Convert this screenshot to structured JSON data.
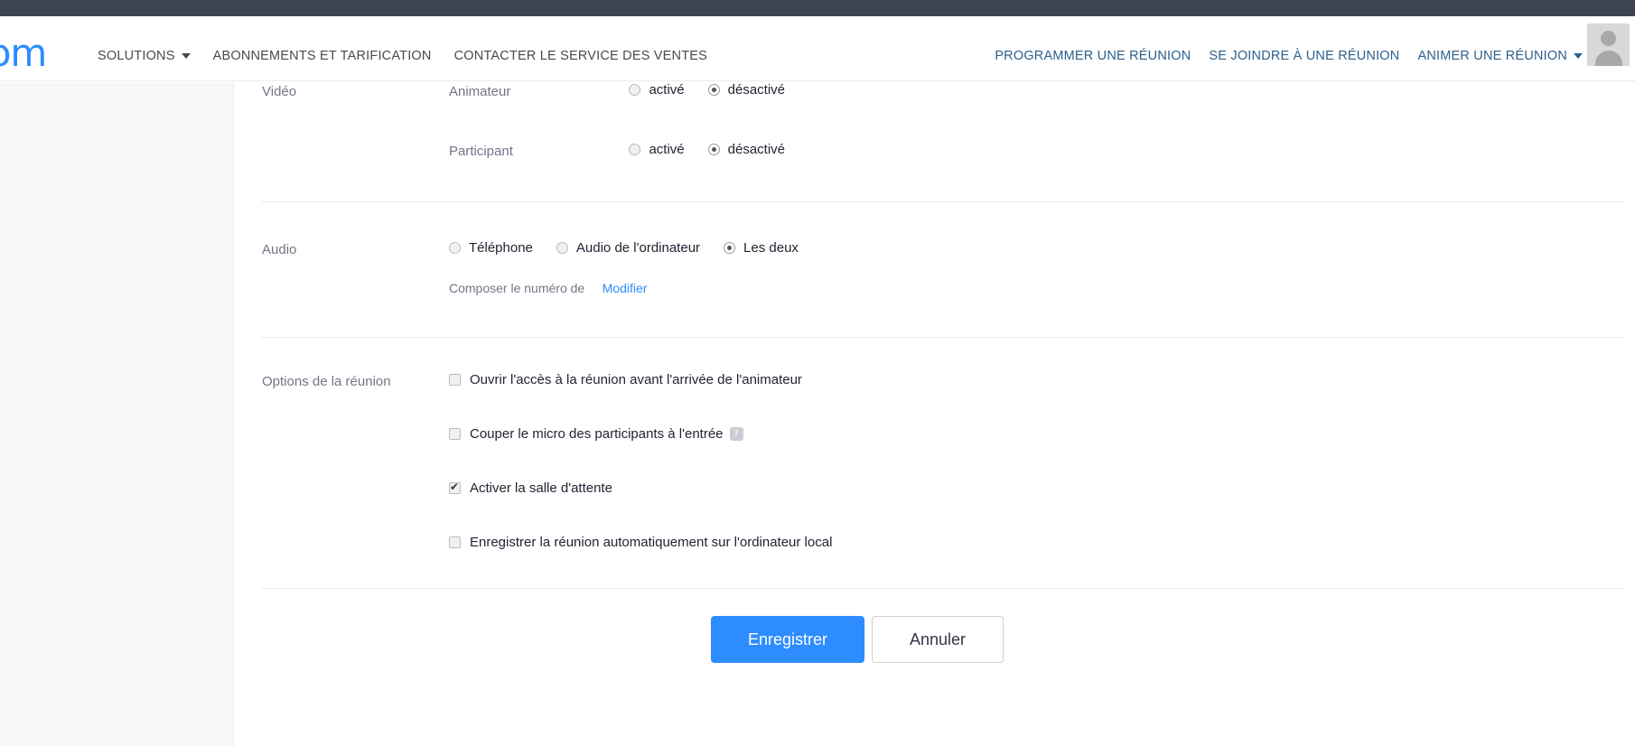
{
  "header": {
    "logo_text": "oom",
    "nav_left": [
      {
        "label": "SOLUTIONS",
        "caret": true
      },
      {
        "label": "ABONNEMENTS ET TARIFICATION",
        "caret": false
      },
      {
        "label": "CONTACTER LE SERVICE DES VENTES",
        "caret": false
      }
    ],
    "nav_right": [
      {
        "label": "PROGRAMMER UNE RÉUNION",
        "caret": false
      },
      {
        "label": "SE JOINDRE À UNE RÉUNION",
        "caret": false
      },
      {
        "label": "ANIMER UNE RÉUNION",
        "caret": true
      }
    ]
  },
  "form": {
    "video": {
      "label": "Vidéo",
      "rows": [
        {
          "sub_label": "Animateur",
          "options": [
            {
              "label": "activé",
              "selected": false
            },
            {
              "label": "désactivé",
              "selected": true
            }
          ]
        },
        {
          "sub_label": "Participant",
          "options": [
            {
              "label": "activé",
              "selected": false
            },
            {
              "label": "désactivé",
              "selected": true
            }
          ]
        }
      ]
    },
    "audio": {
      "label": "Audio",
      "options": [
        {
          "label": "Téléphone",
          "selected": false
        },
        {
          "label": "Audio de l'ordinateur",
          "selected": false
        },
        {
          "label": "Les deux",
          "selected": true
        }
      ],
      "dial_in_note": "Composer le numéro de",
      "dial_in_link": "Modifier"
    },
    "meeting_options": {
      "label": "Options de la réunion",
      "items": [
        {
          "label": "Ouvrir l'accès à la réunion avant l'arrivée de l'animateur",
          "checked": false,
          "badge": ""
        },
        {
          "label": "Couper le micro des participants à l'entrée",
          "checked": false,
          "badge": "?"
        },
        {
          "label": "Activer la salle d'attente",
          "checked": true,
          "badge": ""
        },
        {
          "label": "Enregistrer la réunion automatiquement sur l'ordinateur local",
          "checked": false,
          "badge": ""
        }
      ]
    },
    "actions": {
      "save_label": "Enregistrer",
      "cancel_label": "Annuler"
    }
  },
  "colors": {
    "accent_blue": "#2d8cff",
    "link_blue": "#2d5f8b",
    "topbar_dark": "#3d4353",
    "sidebar_grey": "#f7f7f7"
  }
}
